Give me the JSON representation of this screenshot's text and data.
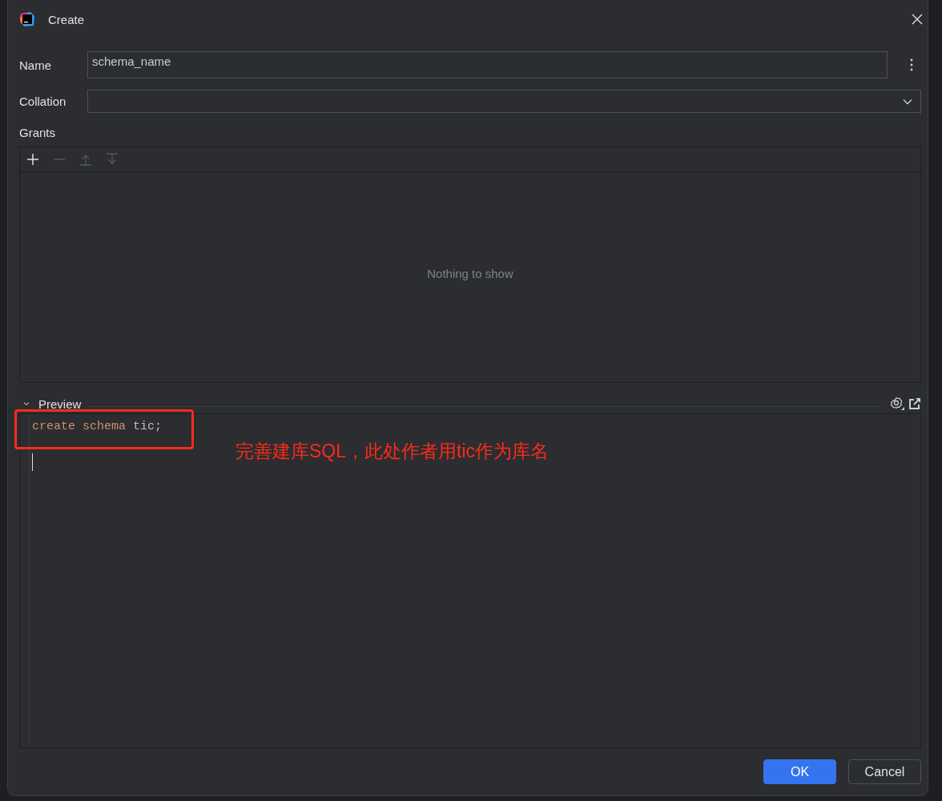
{
  "window": {
    "title": "Create"
  },
  "fields": [
    {
      "label": "Name",
      "kind": "text",
      "value": "schema_name"
    },
    {
      "label": "Collation",
      "kind": "dropdown"
    }
  ],
  "grants": {
    "label": "Grants",
    "toolbar": [
      {
        "kind": "add",
        "disabled": false
      },
      {
        "kind": "remove",
        "disabled": true
      },
      {
        "kind": "up",
        "disabled": true
      },
      {
        "kind": "down",
        "disabled": true
      }
    ],
    "empty_text": "Nothing to show"
  },
  "preview": {
    "label": "Preview",
    "expanded": true,
    "code": [
      {
        "kind": "keyword",
        "text": "create schema"
      },
      {
        "kind": "plain",
        "text": "tic;"
      }
    ]
  },
  "annotation": {
    "text": "完善建库SQL，此处作者用tic作为库名"
  },
  "buttons": [
    {
      "label": "OK",
      "kind": "primary"
    },
    {
      "label": "Cancel",
      "kind": "secondary"
    }
  ]
}
